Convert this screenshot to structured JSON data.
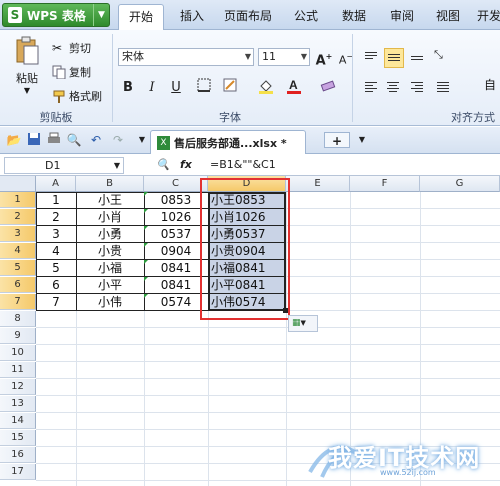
{
  "app": {
    "title": "WPS 表格",
    "logo_letter": "S"
  },
  "menu_tabs": [
    "开始",
    "插入",
    "页面布局",
    "公式",
    "数据",
    "审阅",
    "视图",
    "开发"
  ],
  "ribbon": {
    "clipboard": {
      "paste": "粘贴",
      "cut": "剪切",
      "copy": "复制",
      "format_painter": "格式刷",
      "group": "剪贴板"
    },
    "font": {
      "name": "宋体",
      "size": "11",
      "group": "字体"
    },
    "alignment": {
      "group": "对齐方式",
      "auto": "自"
    }
  },
  "tabbar": {
    "doc_name": "售后服务部通...xlsx *",
    "new_tab": "+"
  },
  "formula_bar": {
    "cell_ref": "D1",
    "fx": "fx",
    "formula": "=B1&\"\"&C1"
  },
  "columns": [
    "A",
    "B",
    "C",
    "D",
    "E",
    "F",
    "G"
  ],
  "rows": [
    "1",
    "2",
    "3",
    "4",
    "5",
    "6",
    "7",
    "8",
    "9",
    "10",
    "11",
    "12",
    "13",
    "14",
    "15",
    "16",
    "17"
  ],
  "table": [
    {
      "a": "1",
      "b": "小王",
      "c": "0853",
      "d": "小王0853"
    },
    {
      "a": "2",
      "b": "小肖",
      "c": "1026",
      "d": "小肖1026"
    },
    {
      "a": "3",
      "b": "小勇",
      "c": "0537",
      "d": "小勇0537"
    },
    {
      "a": "4",
      "b": "小贵",
      "c": "0904",
      "d": "小贵0904"
    },
    {
      "a": "5",
      "b": "小福",
      "c": "0841",
      "d": "小福0841"
    },
    {
      "a": "6",
      "b": "小平",
      "c": "0841",
      "d": "小平0841"
    },
    {
      "a": "7",
      "b": "小伟",
      "c": "0574",
      "d": "小伟0574"
    }
  ],
  "watermark": {
    "text": "我爱IT技术网",
    "url": "www.52ij.com"
  },
  "colors": {
    "accent_red": "#e23131",
    "selection": "#c9d3e6",
    "header_highlight": "#f5c96a",
    "app_green": "#2f8a2c"
  }
}
